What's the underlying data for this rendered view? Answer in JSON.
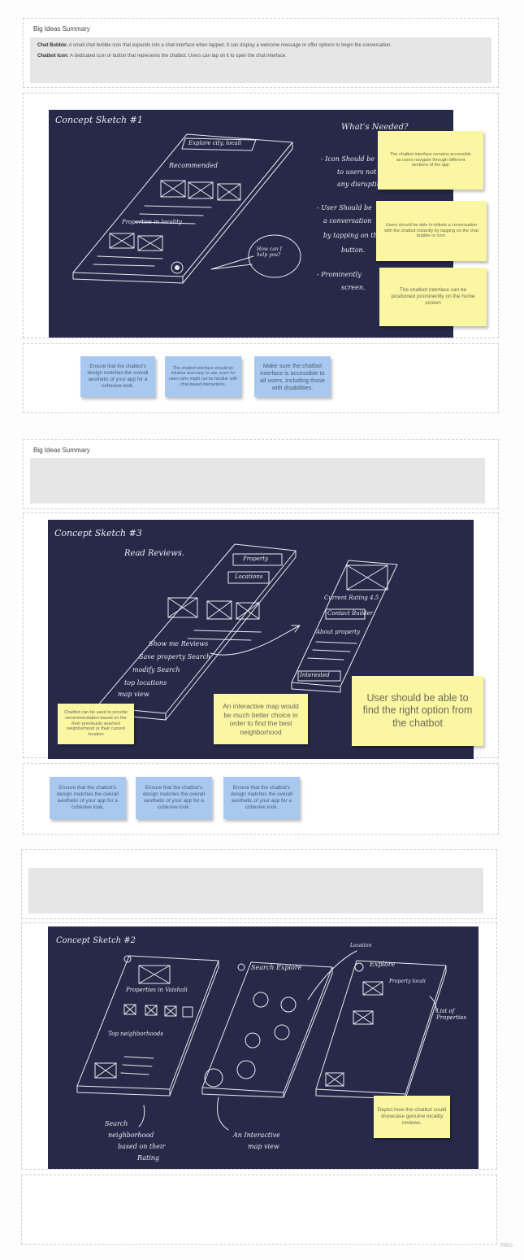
{
  "section1": {
    "summary_title": "Big Ideas Summary",
    "items": [
      {
        "label": "Chat Bubble:",
        "text": " A small chat bubble icon that expands into a chat interface when tapped. It can display a welcome message or offer options to begin the conversation."
      },
      {
        "label": "Chatbot Icon:",
        "text": " A dedicated icon or button that represents the chatbot. Users can tap on it to open the chat interface."
      }
    ],
    "sketch_title": "Concept Sketch #1",
    "sketch_texts": {
      "search": "Explore city, locali",
      "recommended": "Recommended",
      "properties": "Properties in locality",
      "bubble": "How can I help you?",
      "whats": "What's Needed?",
      "n1": "- Icon Should be",
      "n1b": "to users not",
      "n1c": "any disrupting",
      "n2": "- User Should be",
      "n2b": "a conversation",
      "n2c": "by tapping on the",
      "n2d": "button.",
      "n3": "- Prominently",
      "n3b": "screen."
    },
    "yellow_notes": [
      "The chatbot interface remains accessible as users navigate through different sections of the app",
      "Users should be able to initiate a conversation with the chatbot instantly by tapping on the chat bubble or icon.",
      "The chatbot interface can be positioned prominently on the home screen"
    ],
    "blue_notes": [
      "Ensure that the chatbot's design matches the overall aesthetic of your app for a cohesive look.",
      "The chatbot interface should be intuitive and easy to use, even for users who might not be familiar with chat-based interactions.",
      "Make sure the chatbot interface is accessible to all users, including those with disabilities."
    ]
  },
  "section2": {
    "summary_title": "Big Ideas Summary",
    "sketch_title": "Concept Sketch #3",
    "sketch_texts": {
      "read_reviews": "Read Reviews.",
      "btn1": "Property",
      "btn2": "Locations",
      "l1": "Show me Reviews",
      "l2": "Save property Search",
      "l3": "modify Search",
      "l4": "top locations",
      "l5": "map view",
      "r1": "Current Rating 4.5",
      "r2": "Contact Builder",
      "r3": "About property",
      "r4": "Interested"
    },
    "yellow_notes": [
      "Chatbot can be used to provide recommendation based on the their previously searhed neighborhood or their current location",
      "An interactive map would be much better choice in order to find the best neighborhood",
      "User should be able to find the right option from the chatbot"
    ],
    "blue_notes": [
      "Ensure that the chatbot's design matches the overall aesthetic of your app for a cohesive look.",
      "Ensure that the chatbot's design matches the overall aesthetic of your app for a cohesive look.",
      "Ensure that the chatbot's design matches the overall aesthetic of your app for a cohesive look."
    ]
  },
  "section3": {
    "sketch_title": "Concept Sketch #2",
    "sketch_texts": {
      "p1": "Properties in Vaishali",
      "p2": "Top neighborhoods",
      "s1": "Search Explore",
      "s2": "Explore",
      "loc": "Location",
      "prop": "Property locali",
      "list": "List of Properties",
      "a1": "Search",
      "a2": "neighborhood",
      "a3": "based on their",
      "a4": "Rating",
      "b1": "An Interactive",
      "b2": "map view"
    },
    "yellow_notes": [
      "Depict how the chatbot could showcase genuine locality reviews."
    ]
  },
  "watermark": "miro",
  "colors": {
    "board": "#262a48",
    "sticky_yellow": "#fbf6a2",
    "sticky_blue": "#a8c8ef"
  }
}
